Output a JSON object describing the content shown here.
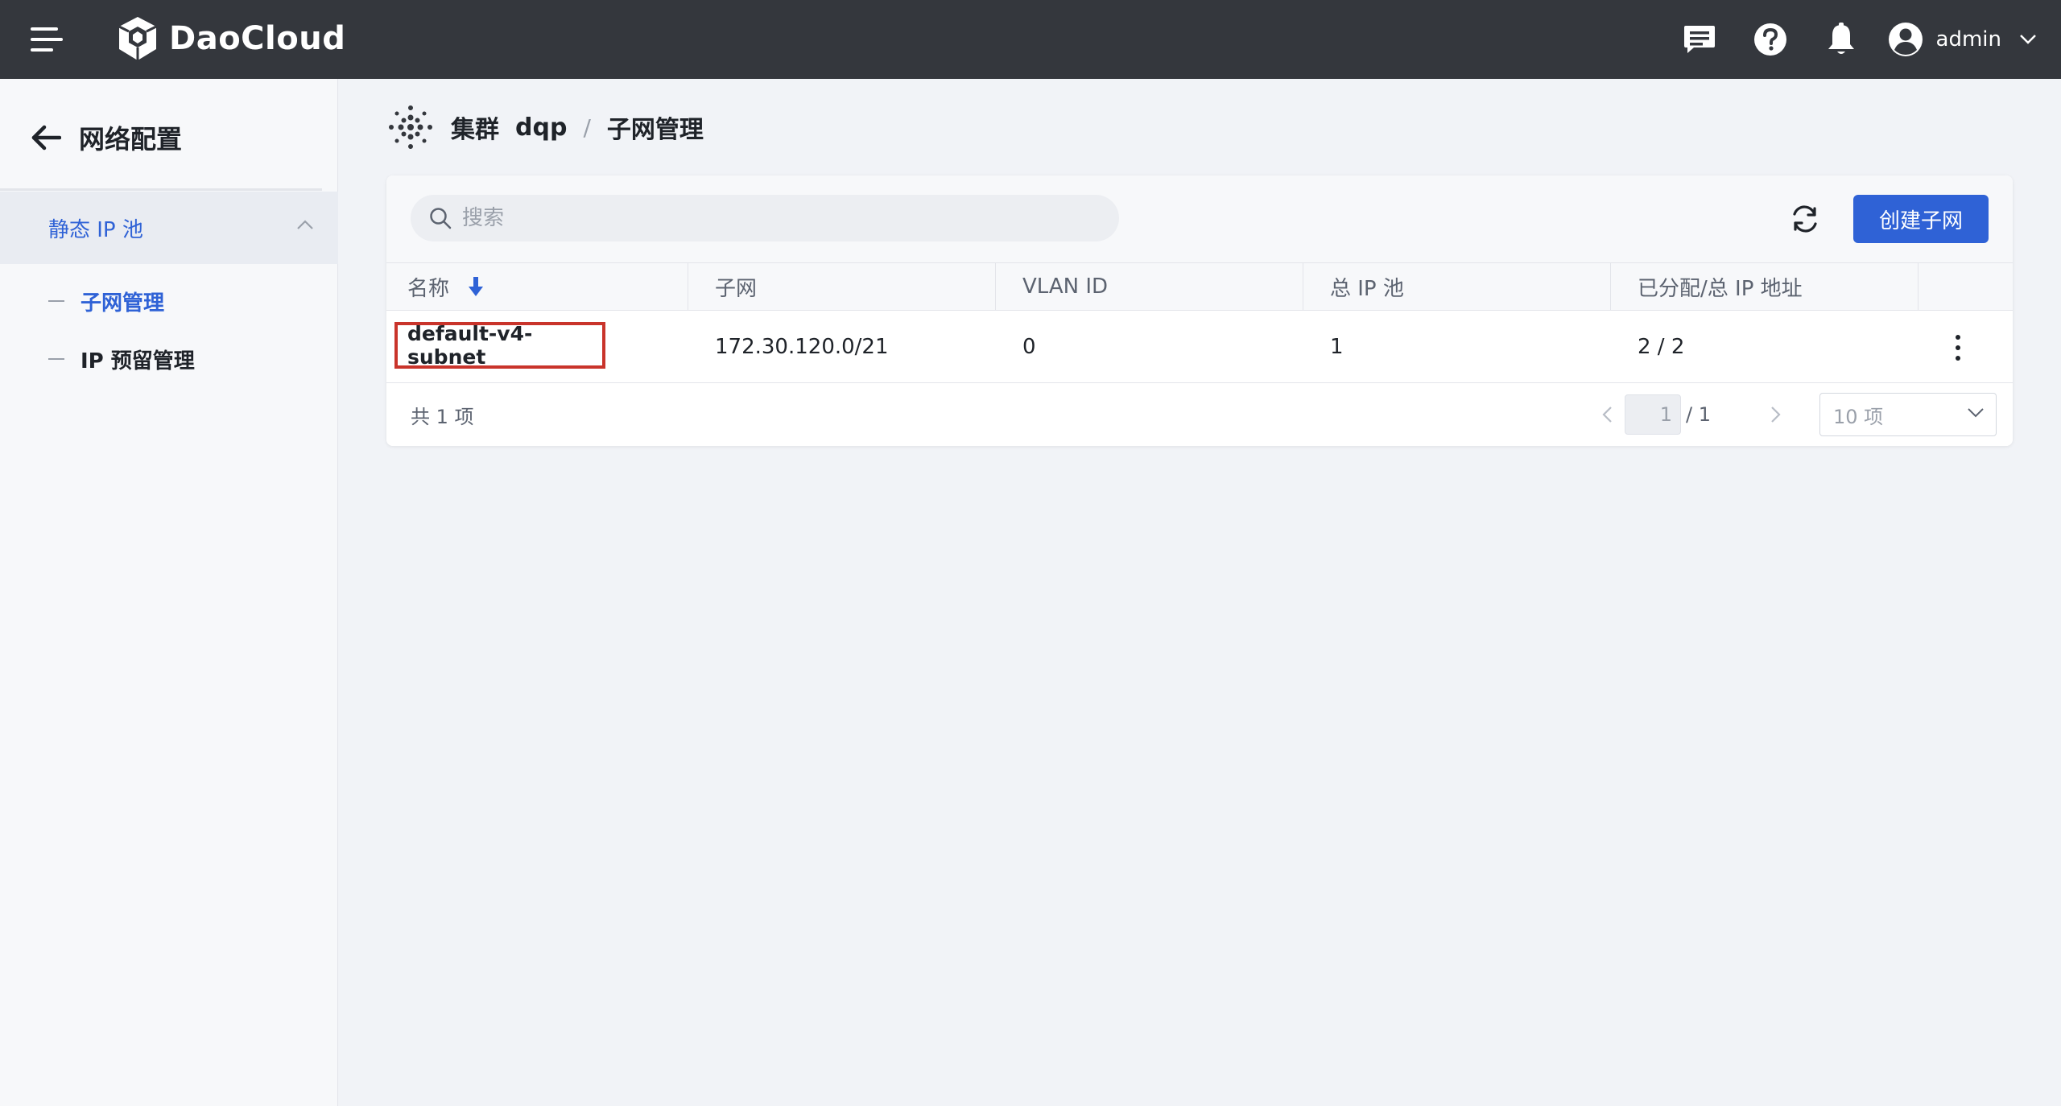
{
  "app": {
    "brand": "DaoCloud",
    "user": "admin"
  },
  "sidebar": {
    "back_label": "网络配置",
    "group_label": "静态 IP 池",
    "items": [
      {
        "label": "子网管理",
        "active": true
      },
      {
        "label": "IP 预留管理",
        "active": false
      }
    ]
  },
  "breadcrumb": {
    "cluster_label": "集群",
    "cluster_name": "dqp",
    "separator": "/",
    "page": "子网管理"
  },
  "toolbar": {
    "search_placeholder": "搜索",
    "create_label": "创建子网"
  },
  "table": {
    "columns": [
      "名称",
      "子网",
      "VLAN ID",
      "总 IP 池",
      "已分配/总 IP 地址"
    ],
    "rows": [
      {
        "name": "default-v4-subnet",
        "subnet": "172.30.120.0/21",
        "vlan": "0",
        "ip_pools": "1",
        "allocated": "2 / 2"
      }
    ]
  },
  "footer": {
    "total": "共 1 项",
    "current_page": "1",
    "page_total": "/ 1",
    "page_size": "10 项"
  },
  "colors": {
    "topbar": "#34373d",
    "accent": "#2f62d6",
    "highlight": "#c9342b"
  }
}
